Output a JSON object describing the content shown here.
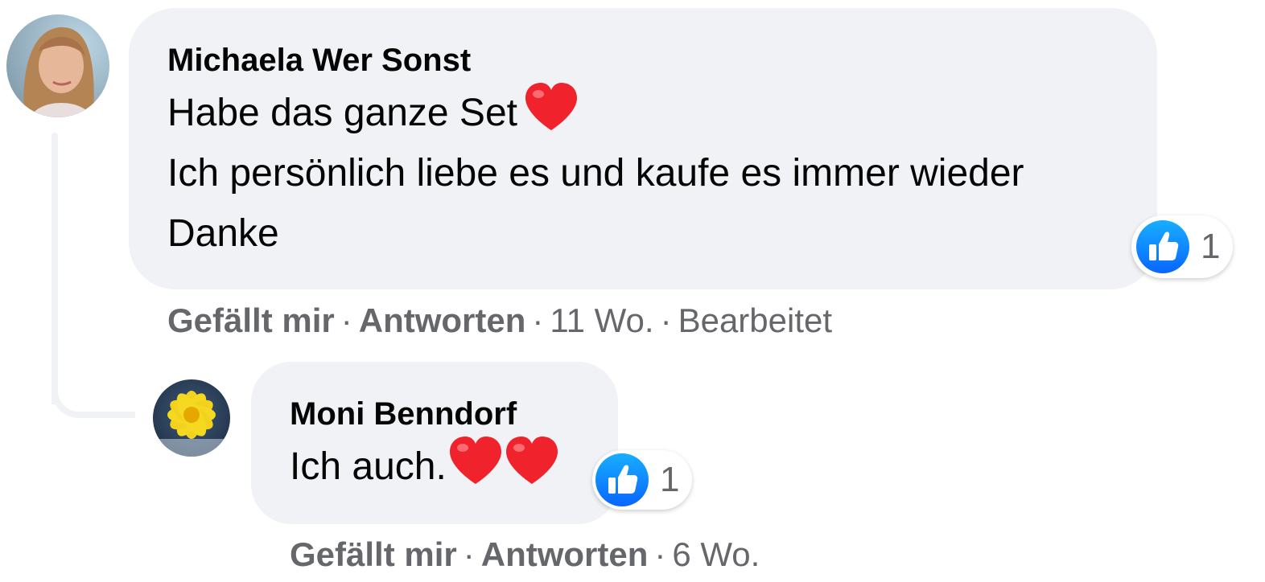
{
  "comments": [
    {
      "author": "Michaela Wer Sonst",
      "lines": [
        "Habe das ganze Set",
        "Ich persönlich liebe es und kaufe es immer wieder",
        "Danke"
      ],
      "emoji": [
        "red-heart"
      ],
      "reaction": {
        "type": "like",
        "count": "1"
      },
      "actions": {
        "like": "Gefällt mir",
        "reply": "Antworten",
        "time": "11 Wo.",
        "edited": "Bearbeitet"
      },
      "avatar": "profile-photo"
    },
    {
      "author": "Moni Benndorf",
      "lines": [
        "Ich auch."
      ],
      "emoji": [
        "red-heart",
        "red-heart"
      ],
      "reaction": {
        "type": "like",
        "count": "1"
      },
      "actions": {
        "like": "Gefällt mir",
        "reply": "Antworten",
        "time": "6 Wo."
      },
      "avatar": "yellow-flower-photo"
    }
  ],
  "separator": "·",
  "colors": {
    "bubble": "#f0f2f5",
    "meta": "#65676b",
    "like_blue": "#1877f2",
    "heart": "#f0232c"
  }
}
